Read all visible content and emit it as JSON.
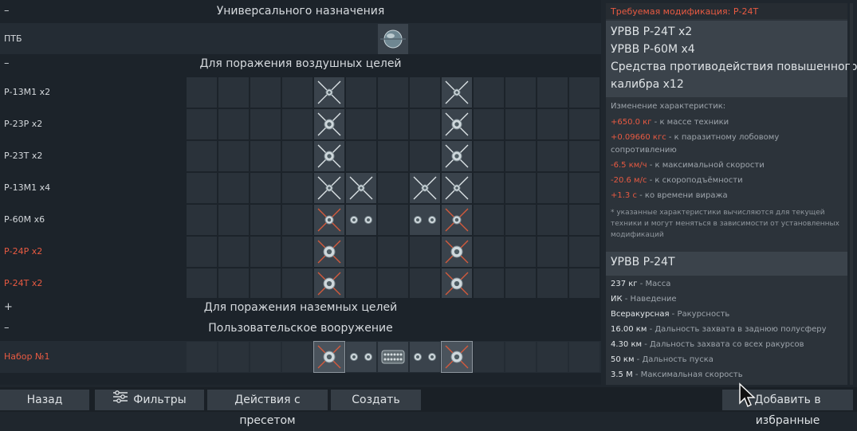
{
  "sections": {
    "universal": {
      "toggle": "–",
      "title": "Универсального назначения"
    },
    "air": {
      "toggle": "–",
      "title": "Для поражения воздушных целей"
    },
    "ground": {
      "toggle": "+",
      "title": "Для поражения наземных целей"
    },
    "custom": {
      "toggle": "–",
      "title": "Пользовательское вооружение"
    }
  },
  "rows": {
    "ptb": "ПТБ",
    "r13m1x2": "Р-13М1 x2",
    "r23rx2": "Р-23Р x2",
    "r23tx2": "Р-23Т x2",
    "r13m1x4": "Р-13М1 x4",
    "r60mx6": "Р-60М x6",
    "r24rx2": "Р-24Р x2",
    "r24tx2": "Р-24Т x2",
    "preset1": "Набор №1"
  },
  "panel": {
    "required_mod": "Требуемая модификация: Р-24Т",
    "loadout": [
      "УРВВ Р-24Т x2",
      "УРВВ Р-60М x4",
      "Средства противодействия повышенного",
      "калибра x12"
    ],
    "changes_title": "Изменение характеристик:",
    "changes": [
      {
        "value": "+650.0 кг",
        "text": " - к массе техники"
      },
      {
        "value": "+0.09660 кгс",
        "text": " - к паразитному лобовому"
      },
      {
        "value": "",
        "text": "сопротивлению"
      },
      {
        "value": "-6.5 км/ч",
        "text": " - к максимальной скорости"
      },
      {
        "value": "-20.6 м/с",
        "text": " - к скороподъёмности"
      },
      {
        "value": "+1.3 с",
        "text": " - ко времени виража"
      }
    ],
    "note": "* указанные характеристики вычисляются для текущей техники и могут меняться в зависимости от установленных модификаций",
    "missile_title": "УРВВ Р-24Т",
    "missile_stats": [
      {
        "value": "237 кг",
        "text": " - Масса"
      },
      {
        "value": "ИК",
        "text": " - Наведение"
      },
      {
        "value": "Всеракурсная",
        "text": " - Ракурсность"
      },
      {
        "value": "16.00 км",
        "text": " - Дальность захвата в заднюю полусферу"
      },
      {
        "value": "4.30 км",
        "text": " - Дальность захвата со всех ракурсов"
      },
      {
        "value": "50 км",
        "text": " - Дальность пуска"
      },
      {
        "value": "3.5 М",
        "text": " - Максимальная скорость"
      }
    ]
  },
  "bottom": {
    "back": "Назад",
    "filters": "Фильтры",
    "preset_actions": "Действия с пресетом",
    "create": "Создать",
    "favorite": "Добавить в избранные"
  },
  "colors": {
    "accent_red": "#e85a42",
    "bg": "#1f262d",
    "cell": "#2a323a"
  }
}
